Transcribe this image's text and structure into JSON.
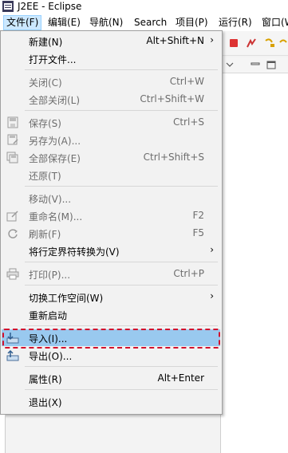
{
  "window": {
    "title": "J2EE - Eclipse"
  },
  "menubar": {
    "items": [
      "文件(F)",
      "编辑(E)",
      "导航(N)",
      "Search",
      "项目(P)",
      "运行(R)",
      "窗口(W"
    ]
  },
  "file_menu": {
    "items": [
      {
        "label": "新建(N)",
        "shortcut": "Alt+Shift+N",
        "submenu": true,
        "enabled": true
      },
      {
        "label": "打开文件...",
        "shortcut": "",
        "enabled": true
      },
      {
        "label": "关闭(C)",
        "shortcut": "Ctrl+W",
        "enabled": false
      },
      {
        "label": "全部关闭(L)",
        "shortcut": "Ctrl+Shift+W",
        "enabled": false
      },
      {
        "label": "保存(S)",
        "shortcut": "Ctrl+S",
        "enabled": false,
        "icon": "save-icon"
      },
      {
        "label": "另存为(A)...",
        "shortcut": "",
        "enabled": false,
        "icon": "save-as-icon"
      },
      {
        "label": "全部保存(E)",
        "shortcut": "Ctrl+Shift+S",
        "enabled": false,
        "icon": "save-all-icon"
      },
      {
        "label": "还原(T)",
        "shortcut": "",
        "enabled": false
      },
      {
        "label": "移动(V)...",
        "shortcut": "",
        "enabled": false
      },
      {
        "label": "重命名(M)...",
        "shortcut": "F2",
        "enabled": false,
        "icon": "rename-icon"
      },
      {
        "label": "刷新(F)",
        "shortcut": "F5",
        "enabled": false,
        "icon": "refresh-icon"
      },
      {
        "label": "将行定界符转换为(V)",
        "shortcut": "",
        "submenu": true,
        "enabled": true
      },
      {
        "label": "打印(P)...",
        "shortcut": "Ctrl+P",
        "enabled": false,
        "icon": "print-icon"
      },
      {
        "label": "切换工作空间(W)",
        "shortcut": "",
        "submenu": true,
        "enabled": true
      },
      {
        "label": "重新启动",
        "shortcut": "",
        "enabled": true
      },
      {
        "label": "导入(I)...",
        "shortcut": "",
        "enabled": true,
        "highlighted": true,
        "icon": "import-icon"
      },
      {
        "label": "导出(O)...",
        "shortcut": "",
        "enabled": true,
        "icon": "export-icon"
      },
      {
        "label": "属性(R)",
        "shortcut": "Alt+Enter",
        "enabled": true
      },
      {
        "label": "退出(X)",
        "shortcut": "",
        "enabled": true
      }
    ]
  },
  "colors": {
    "highlight": "#99c9ef",
    "annotation_border": "#d2122e",
    "menubar_active": "#cce8ff"
  }
}
